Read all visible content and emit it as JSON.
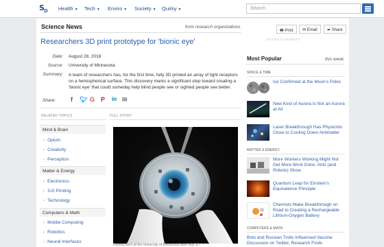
{
  "nav": {
    "logo": "S",
    "logo_sub": "D",
    "items": [
      "Health",
      "Tech",
      "Enviro",
      "Society",
      "Quirky"
    ],
    "search_placeholder": "Search"
  },
  "article": {
    "section": "Science News",
    "source_note": "from research organizations",
    "title": "Researchers 3D print prototype for 'bionic eye'",
    "date_label": "Date:",
    "date": "August 28, 2018",
    "source_label": "Source:",
    "source": "University of Minnesota",
    "summary_label": "Summary:",
    "summary": "A team of researchers has, for the first time, fully 3D printed an array of light receptors on a hemispherical surface. This discovery marks a significant step toward creating a 'bionic eye' that could someday help blind people see or sighted people see better.",
    "share_label": "Share:",
    "related_header": "RELATED TOPICS",
    "full_story_header": "FULL STORY",
    "caption": "Researchers at the University of Minnesota have fully 3D"
  },
  "related": {
    "cat1": "Mind & Brain",
    "cat1_items": [
      "Opium",
      "Creativity",
      "Perception"
    ],
    "cat2": "Matter & Energy",
    "cat2_items": [
      "Electronics",
      "3-D Printing",
      "Technology"
    ],
    "cat3": "Computers & Math",
    "cat3_items": [
      "Mobile Computing",
      "Robotics",
      "Neural Interfaces"
    ]
  },
  "tools": {
    "print": "Print",
    "email": "Email",
    "share": "Share"
  },
  "sidebar": {
    "advert_label": "ADVERTISEMENT",
    "most_popular": "Most Popular",
    "this_week": "this week",
    "cat_space": "SPACE & TIME",
    "cat_matter": "MATTER & ENERGY",
    "cat_computers": "COMPUTERS & MATH",
    "stories": [
      "Ice Confirmed at the Moon's Poles",
      "New Kind of Aurora Is Not an Aurora at All",
      "Laser Breakthrough Has Physicists Close to Cooling Down Antimatter",
      "More Workers Working Might Not Get More Work Done, Ants (and Robots) Show",
      "Quantum Leap for Einstein's Equivalence Principle",
      "Chemists Make Breakthrough on Road to Creating a Rechargeable Lithium-Oxygen Battery",
      "Bots and Russian Trolls Influenced Vaccine Discussion on Twitter, Research Finds"
    ]
  },
  "colors": {
    "link": "#2e5fae",
    "nav_text": "#1f4e8c",
    "menu_button": "#2f69b3",
    "facebook": "#3b5998",
    "twitter": "#1da1f2",
    "google": "#dd4b39",
    "pinterest": "#cb2027",
    "linkedin": "#0077b5"
  }
}
